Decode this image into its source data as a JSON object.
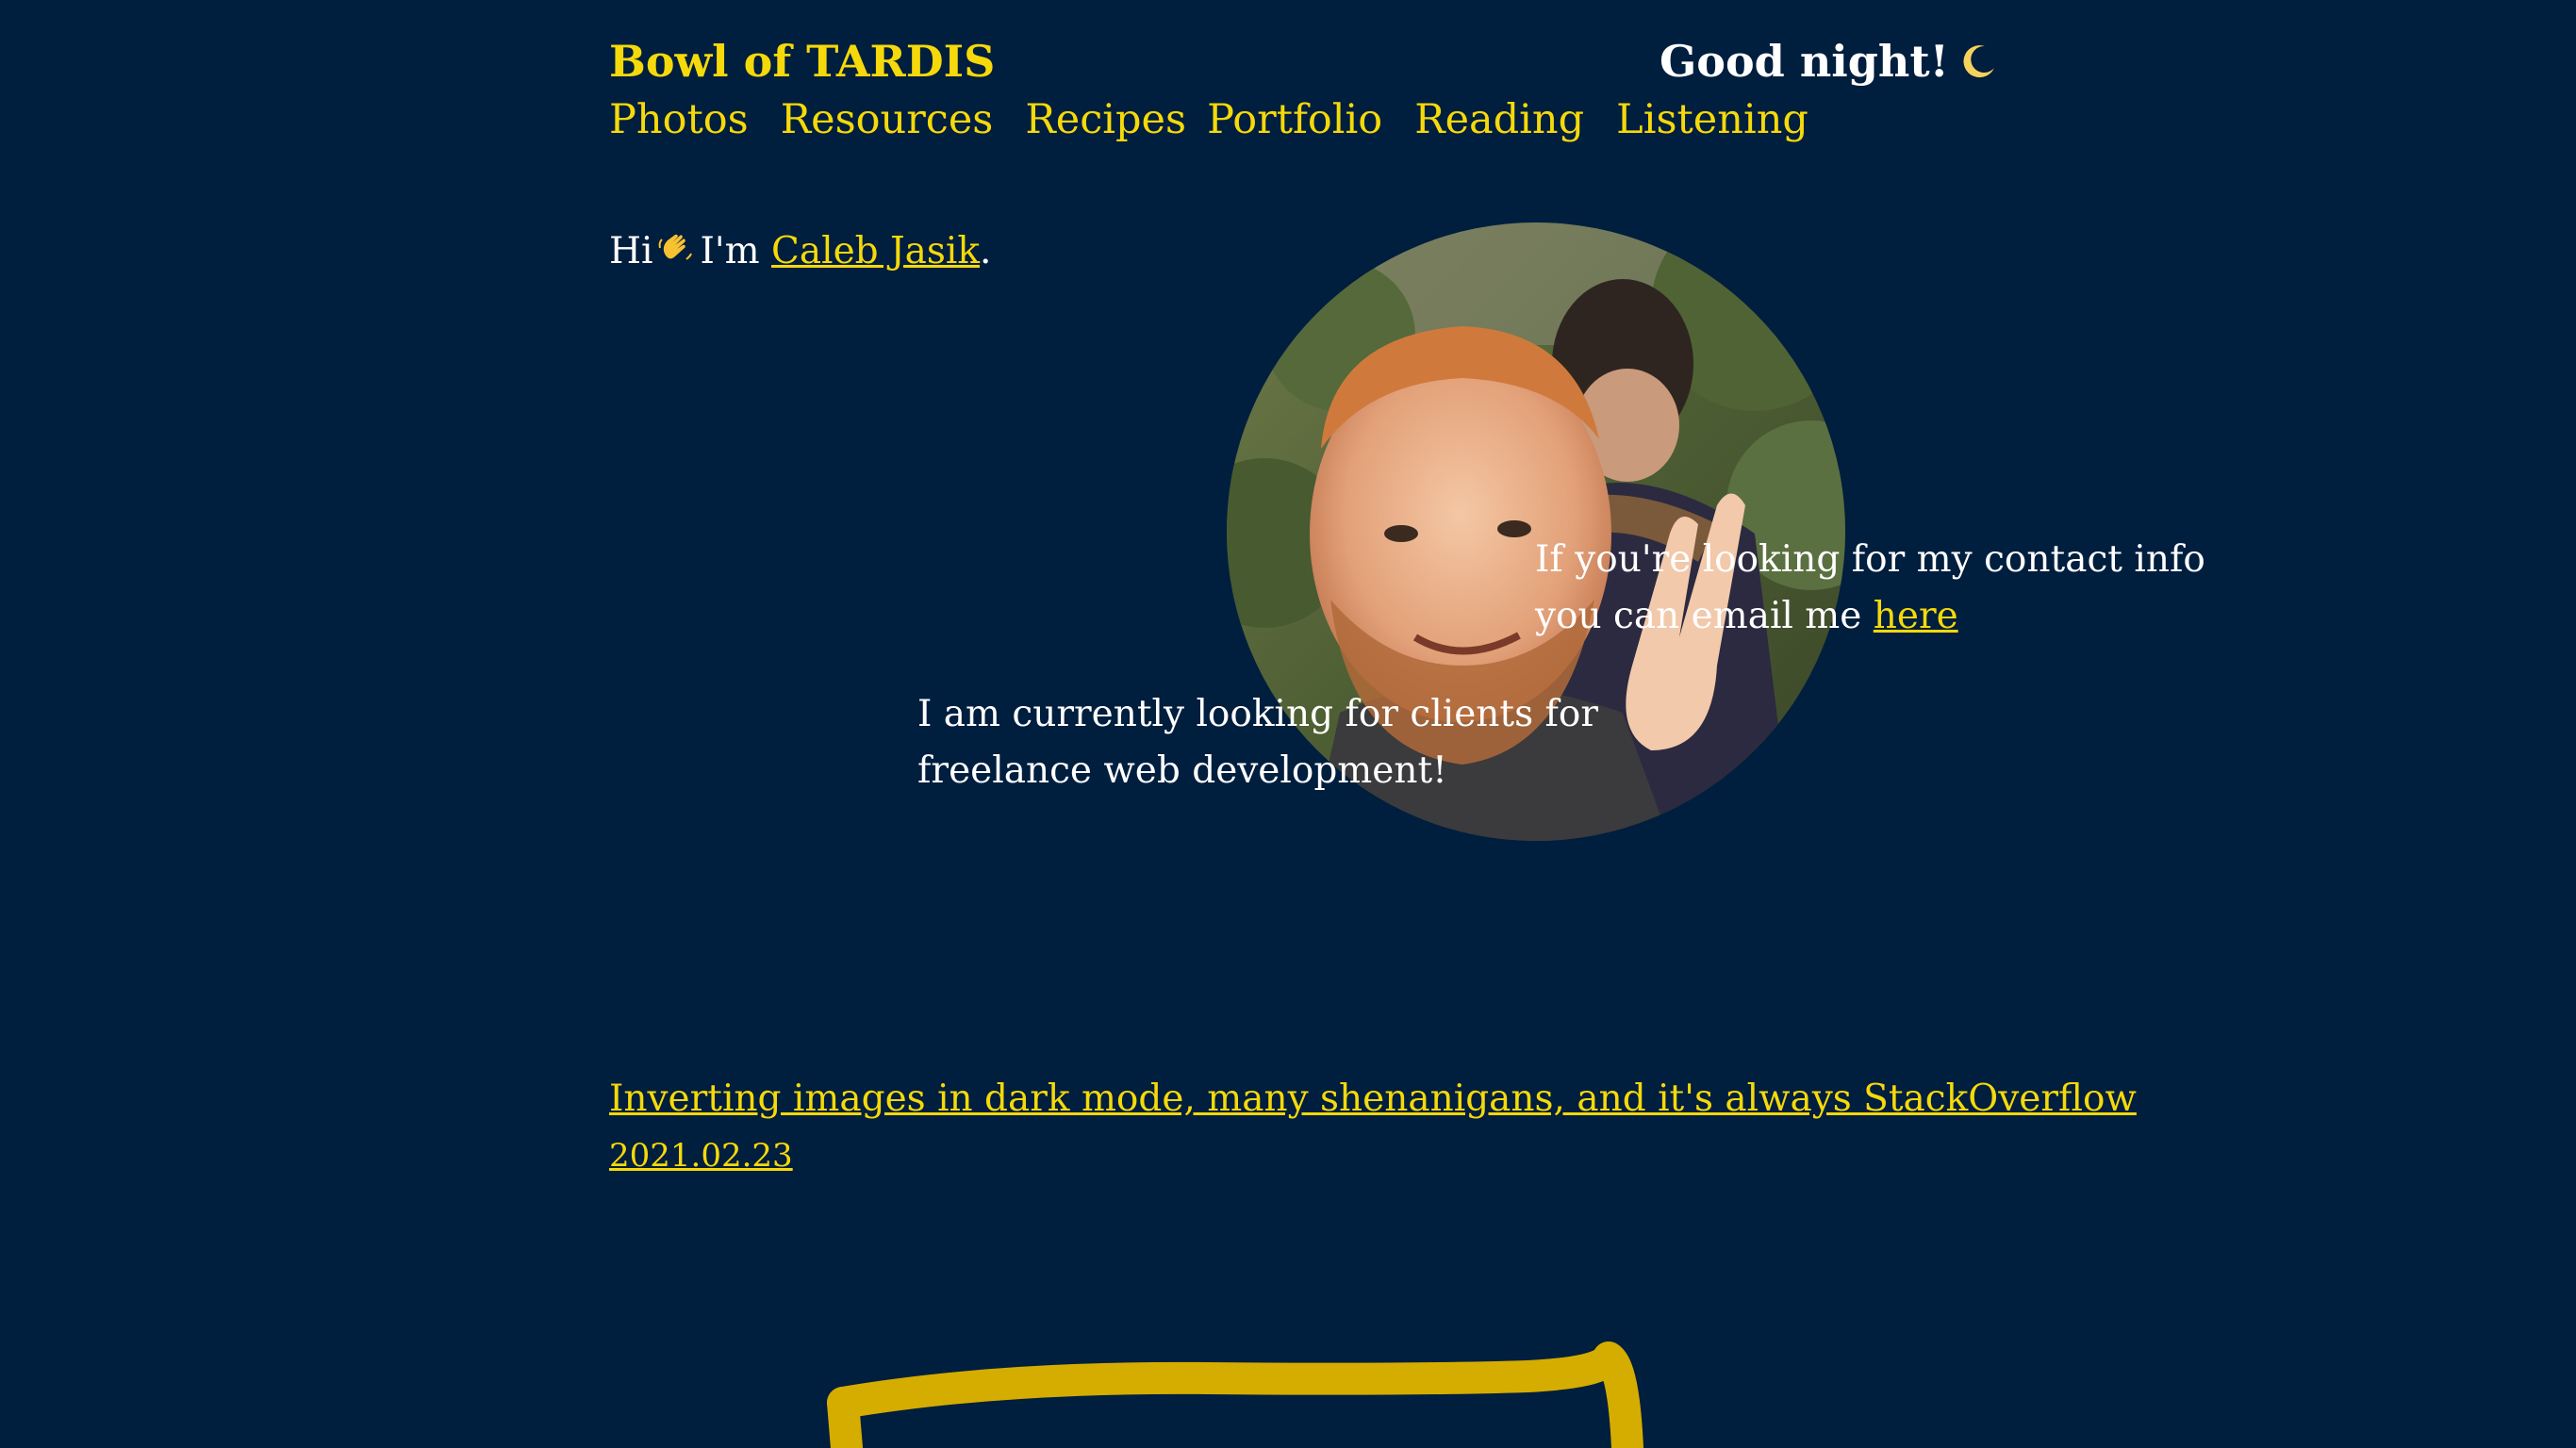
{
  "header": {
    "site_title": "Bowl of TARDIS",
    "greeting": "Good night!",
    "greeting_icon": "moon-icon"
  },
  "nav": {
    "items": [
      {
        "label": "Photos"
      },
      {
        "label": "Resources"
      },
      {
        "label": "Recipes"
      },
      {
        "label": "Portfolio"
      },
      {
        "label": "Reading"
      },
      {
        "label": "Listening"
      }
    ]
  },
  "intro": {
    "prefix": "Hi",
    "wave_icon": "waving-hand-icon",
    "im": "I'm",
    "name_link": "Caleb Jasik",
    "suffix": "."
  },
  "contact": {
    "line1": "If you're looking for my contact info",
    "line2_prefix": "you can email me",
    "link": "here"
  },
  "freelance": {
    "line1": "I am currently looking for clients for",
    "line2": "freelance web development!"
  },
  "posts": [
    {
      "title": "Inverting images in dark mode, many shenanigans, and it's always StackOverflow",
      "date": "2021.02.23"
    }
  ],
  "colors": {
    "background": "#001e3e",
    "accent": "#f5d90a",
    "text": "#ffffff",
    "scribble": "#d4ad00"
  }
}
